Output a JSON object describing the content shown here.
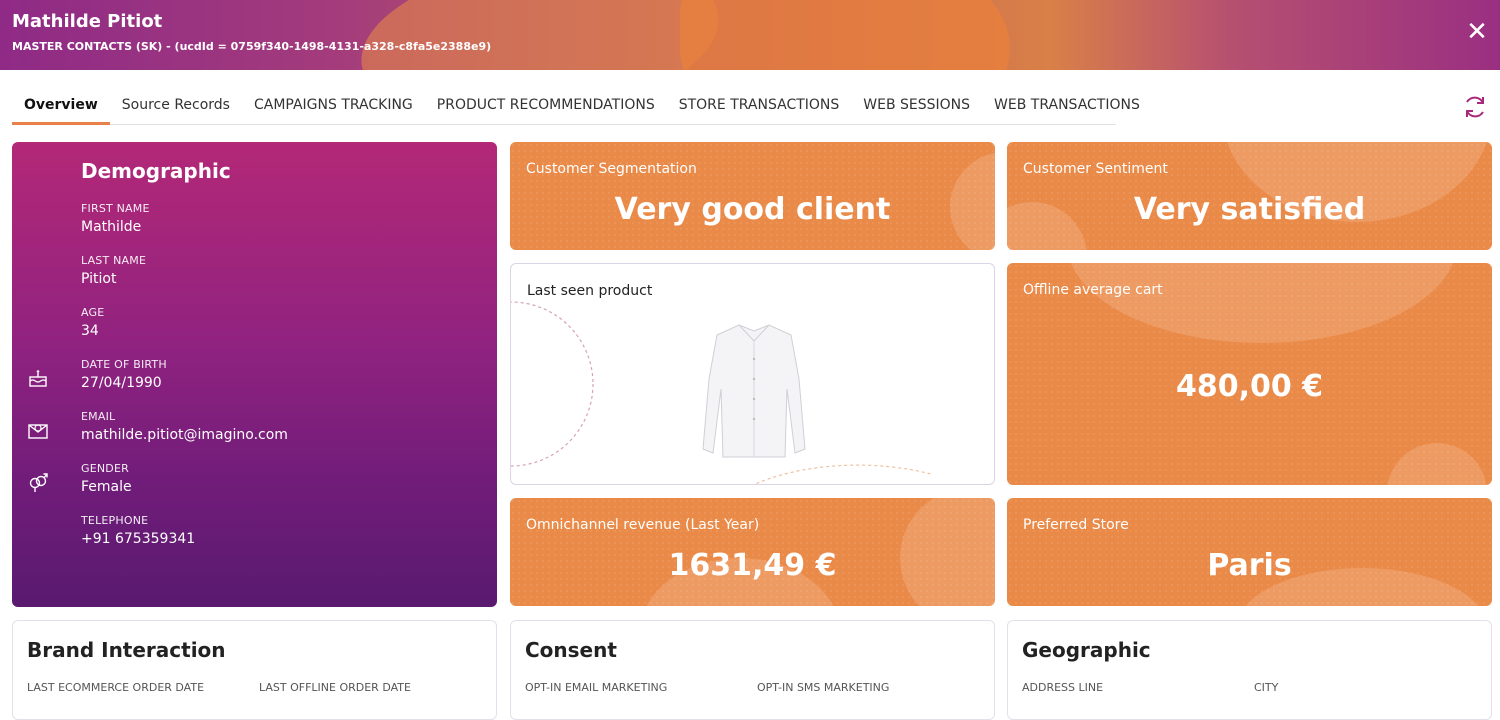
{
  "header": {
    "title": "Mathilde Pitiot",
    "subtitle": "MASTER CONTACTS (SK) - (ucdId = 0759f340-1498-4131-a328-c8fa5e2388e9)",
    "close_label": "✕"
  },
  "tabs": [
    {
      "label": "Overview",
      "active": true
    },
    {
      "label": "Source Records",
      "active": false
    },
    {
      "label": "CAMPAIGNS TRACKING",
      "active": false
    },
    {
      "label": "PRODUCT RECOMMENDATIONS",
      "active": false
    },
    {
      "label": "STORE TRANSACTIONS",
      "active": false
    },
    {
      "label": "WEB SESSIONS",
      "active": false
    },
    {
      "label": "WEB TRANSACTIONS",
      "active": false
    }
  ],
  "demographic": {
    "title": "Demographic",
    "fields": [
      {
        "label": "FIRST NAME",
        "value": "Mathilde"
      },
      {
        "label": "LAST NAME",
        "value": "Pitiot"
      },
      {
        "label": "AGE",
        "value": "34"
      },
      {
        "label": "DATE OF BIRTH",
        "value": "27/04/1990",
        "icon": "cake-icon"
      },
      {
        "label": "EMAIL",
        "value": "mathilde.pitiot@imagino.com",
        "icon": "email-icon"
      },
      {
        "label": "GENDER",
        "value": "Female",
        "icon": "gender-icon"
      },
      {
        "label": "TELEPHONE",
        "value": "+91 675359341"
      }
    ]
  },
  "cards": {
    "segmentation": {
      "label": "Customer Segmentation",
      "value": "Very good client"
    },
    "sentiment": {
      "label": "Customer Sentiment",
      "value": "Very satisfied"
    },
    "last_seen": {
      "label": "Last seen product",
      "image": "white-shirt"
    },
    "avg_cart": {
      "label": "Offline average cart",
      "value": "480,00 €"
    },
    "revenue": {
      "label": "Omnichannel revenue (Last Year)",
      "value": "1631,49 €"
    },
    "store": {
      "label": "Preferred Store",
      "value": "Paris"
    }
  },
  "bottom": {
    "brand": {
      "title": "Brand Interaction",
      "col1": "LAST ECOMMERCE ORDER DATE",
      "col2": "LAST OFFLINE ORDER DATE"
    },
    "consent": {
      "title": "Consent",
      "col1": "OPT-IN EMAIL MARKETING",
      "col2": "OPT-IN SMS MARKETING"
    },
    "geo": {
      "title": "Geographic",
      "col1": "ADDRESS LINE",
      "col2": "CITY"
    }
  },
  "colors": {
    "orange": "#ea8a48",
    "purple": "#8f2280",
    "accent": "#e9814a"
  }
}
